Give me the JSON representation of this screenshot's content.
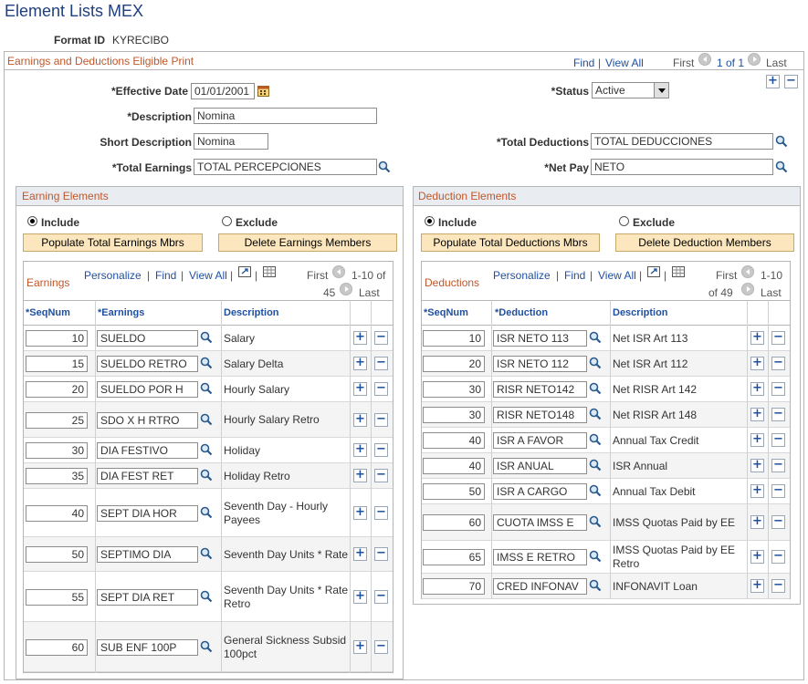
{
  "page_title": "Element Lists MEX",
  "format_id_label": "Format ID",
  "format_id": "KYRECIBO",
  "section": {
    "title": "Earnings and Deductions Eligible Print",
    "find": "Find",
    "view_all": "View All",
    "first": "First",
    "range": "1 of 1",
    "last": "Last"
  },
  "form": {
    "effective_date_label": "*Effective Date",
    "effective_date": "01/01/2001",
    "status_label": "*Status",
    "status": "Active",
    "description_label": "*Description",
    "description": "Nomina",
    "short_description_label": "Short Description",
    "short_description": "Nomina",
    "total_deductions_label": "*Total Deductions",
    "total_deductions": "TOTAL DEDUCCIONES",
    "total_earnings_label": "*Total Earnings",
    "total_earnings": "TOTAL PERCEPCIONES",
    "net_pay_label": "*Net Pay",
    "net_pay": "NETO"
  },
  "earning_elements": {
    "title": "Earning Elements",
    "include": "Include",
    "exclude": "Exclude",
    "populate_btn": "Populate Total Earnings Mbrs",
    "delete_btn": "Delete Earnings Members",
    "grid_title": "Earnings",
    "personalize": "Personalize",
    "find": "Find",
    "view_all": "View All",
    "first": "First",
    "range": "1-10 of",
    "count": "45",
    "last": "Last",
    "col_seq": "*SeqNum",
    "col_code": "*Earnings",
    "col_desc": "Description",
    "rows": [
      {
        "seq": "10",
        "code": "SUELDO",
        "desc": "Salary"
      },
      {
        "seq": "15",
        "code": "SUELDO RETRO",
        "desc": "Salary Delta"
      },
      {
        "seq": "20",
        "code": "SUELDO POR H",
        "desc": "Hourly Salary"
      },
      {
        "seq": "25",
        "code": "SDO X H RTRO",
        "desc": "Hourly Salary Retro"
      },
      {
        "seq": "30",
        "code": "DIA FESTIVO",
        "desc": "Holiday"
      },
      {
        "seq": "35",
        "code": "DIA FEST RET",
        "desc": "Holiday Retro"
      },
      {
        "seq": "40",
        "code": "SEPT DIA HOR",
        "desc": "Seventh Day - Hourly Payees"
      },
      {
        "seq": "50",
        "code": "SEPTIMO DIA",
        "desc": "Seventh Day Units * Rate"
      },
      {
        "seq": "55",
        "code": "SEPT DIA RET",
        "desc": "Seventh Day Units * Rate Retro"
      },
      {
        "seq": "60",
        "code": "SUB ENF 100P",
        "desc": "General Sickness Subsid 100pct"
      }
    ]
  },
  "deduction_elements": {
    "title": "Deduction Elements",
    "include": "Include",
    "exclude": "Exclude",
    "populate_btn": "Populate Total Deductions Mbrs",
    "delete_btn": "Delete Deduction Members",
    "grid_title": "Deductions",
    "personalize": "Personalize",
    "find": "Find",
    "view_all": "View All",
    "first": "First",
    "range": "1-10",
    "count": "of 49",
    "last": "Last",
    "col_seq": "*SeqNum",
    "col_code": "*Deduction",
    "col_desc": "Description",
    "rows": [
      {
        "seq": "10",
        "code": "ISR NETO 113",
        "desc": "Net ISR Art 113"
      },
      {
        "seq": "20",
        "code": "ISR NETO 112",
        "desc": "Net ISR Art 112"
      },
      {
        "seq": "30",
        "code": "RISR NETO142",
        "desc": "Net RISR Art 142"
      },
      {
        "seq": "30",
        "code": "RISR NETO148",
        "desc": "Net RISR Art 148"
      },
      {
        "seq": "40",
        "code": "ISR A FAVOR",
        "desc": "Annual Tax Credit"
      },
      {
        "seq": "40",
        "code": "ISR ANUAL",
        "desc": "ISR Annual"
      },
      {
        "seq": "50",
        "code": "ISR A CARGO",
        "desc": "Annual Tax Debit"
      },
      {
        "seq": "60",
        "code": "CUOTA IMSS E",
        "desc": "IMSS Quotas Paid by EE"
      },
      {
        "seq": "65",
        "code": "IMSS E RETRO",
        "desc": "IMSS Quotas Paid by EE Retro"
      },
      {
        "seq": "70",
        "code": "CRED INFONAV",
        "desc": "INFONAVIT Loan"
      }
    ]
  },
  "colors": {
    "title": "#1f3f7f",
    "section": "#c0572a",
    "link": "#1f4f9f",
    "button": "#fbe6bd"
  },
  "icons": {
    "lookup": "magnifier-icon",
    "calendar": "calendar-icon",
    "add": "plus-icon",
    "delete": "minus-icon",
    "zoom": "zoom-icon",
    "download": "grid-download-icon"
  }
}
